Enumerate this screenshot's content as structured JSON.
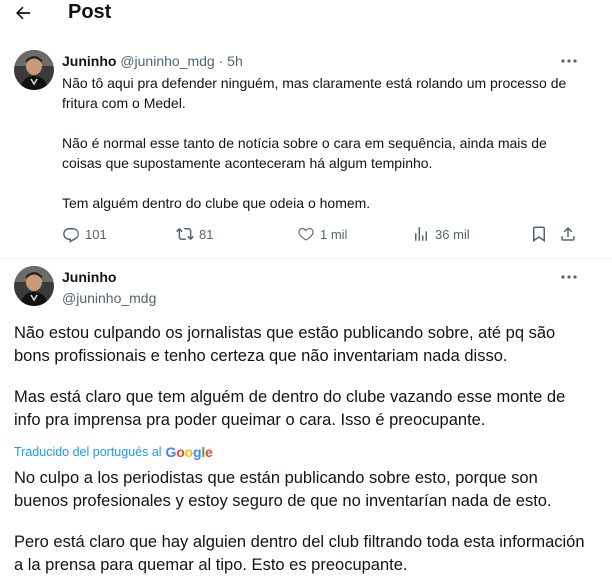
{
  "header": {
    "title": "Post"
  },
  "tweet1": {
    "author_name": "Juninho",
    "handle": "@juninho_mdg",
    "separator": "·",
    "time": "5h",
    "paragraphs": [
      "Não tô aqui pra defender ninguém, mas claramente está rolando um processo de fritura com o Medel.",
      "Não é normal esse tanto de notícia sobre o cara em sequência, ainda mais de coisas que supostamente aconteceram há algum tempinho.",
      "Tem alguém dentro do clube que odeia o homem."
    ],
    "stats": {
      "replies": "101",
      "reposts": "81",
      "likes": "1 mil",
      "views": "36 mil"
    }
  },
  "tweet2": {
    "author_name": "Juninho",
    "handle": "@juninho_mdg",
    "paragraphs": [
      "Não estou culpando os jornalistas que estão publicando sobre, até pq são bons profissionais e tenho certeza que não inventariam nada disso.",
      "Mas está claro que tem alguém de dentro do clube vazando esse monte de info pra imprensa pra poder queimar o cara. Isso é preocupante."
    ],
    "translated_label": "Traducido del portugués al",
    "translator_brand": "Google",
    "translation_paragraphs": [
      "No culpo a los periodistas que están publicando sobre esto, porque son buenos profesionales y estoy seguro de que no inventarían nada de esto.",
      "Pero está claro que hay alguien dentro del club filtrando toda esta información a la prensa para quemar al tipo. Esto es preocupante."
    ]
  },
  "icons": {
    "back": "arrow-left-icon",
    "more": "more-horizontal-icon",
    "reply": "reply-icon",
    "repost": "repost-icon",
    "like": "heart-icon",
    "views": "views-icon",
    "bookmark": "bookmark-icon",
    "share": "share-icon"
  },
  "colors": {
    "text": "#0f1419",
    "muted": "#536471",
    "link": "#1d9bf0",
    "divider": "#eff3f4"
  }
}
